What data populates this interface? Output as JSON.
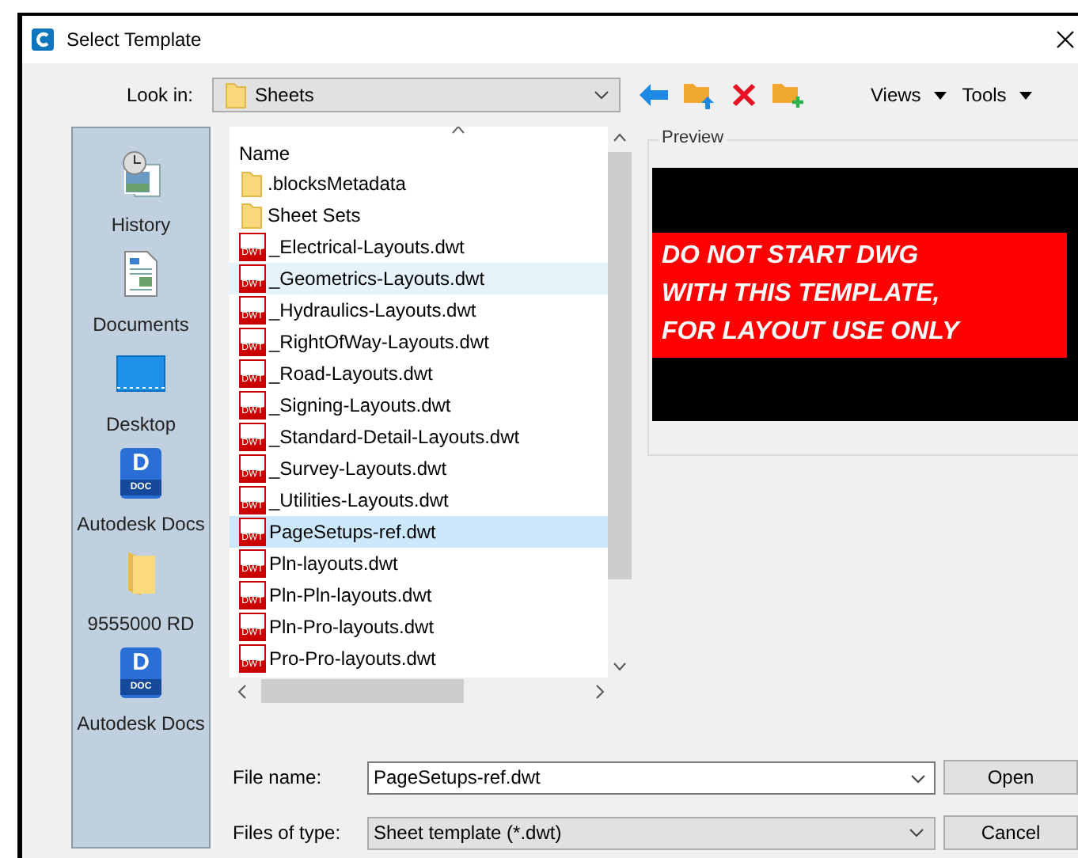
{
  "window": {
    "title": "Select Template"
  },
  "toolbar": {
    "look_in_label": "Look in:",
    "look_in_value": "Sheets",
    "views": "Views",
    "tools": "Tools"
  },
  "places": [
    {
      "kind": "history",
      "label": "History"
    },
    {
      "kind": "documents",
      "label": "Documents"
    },
    {
      "kind": "desktop",
      "label": "Desktop"
    },
    {
      "kind": "docs",
      "label": "Autodesk Docs",
      "badge": "D",
      "badge_caption": "DOC"
    },
    {
      "kind": "folder",
      "label": "9555000 RD"
    },
    {
      "kind": "docs",
      "label": "Autodesk Docs",
      "badge": "D",
      "badge_caption": "DOC"
    }
  ],
  "file_list": {
    "column": "Name",
    "rows": [
      {
        "kind": "folder",
        "name": ".blocksMetadata",
        "selected": false,
        "hover": false
      },
      {
        "kind": "folder",
        "name": "Sheet Sets",
        "selected": false,
        "hover": false
      },
      {
        "kind": "dwt",
        "name": "_Electrical-Layouts.dwt",
        "icon_label": "DWT",
        "selected": false,
        "hover": false
      },
      {
        "kind": "dwt",
        "name": "_Geometrics-Layouts.dwt",
        "icon_label": "DWT",
        "selected": false,
        "hover": true
      },
      {
        "kind": "dwt",
        "name": "_Hydraulics-Layouts.dwt",
        "icon_label": "DWT",
        "selected": false,
        "hover": false
      },
      {
        "kind": "dwt",
        "name": "_RightOfWay-Layouts.dwt",
        "icon_label": "DWT",
        "selected": false,
        "hover": false
      },
      {
        "kind": "dwt",
        "name": "_Road-Layouts.dwt",
        "icon_label": "DWT",
        "selected": false,
        "hover": false
      },
      {
        "kind": "dwt",
        "name": "_Signing-Layouts.dwt",
        "icon_label": "DWT",
        "selected": false,
        "hover": false
      },
      {
        "kind": "dwt",
        "name": "_Standard-Detail-Layouts.dwt",
        "icon_label": "DWT",
        "selected": false,
        "hover": false
      },
      {
        "kind": "dwt",
        "name": "_Survey-Layouts.dwt",
        "icon_label": "DWT",
        "selected": false,
        "hover": false
      },
      {
        "kind": "dwt",
        "name": "_Utilities-Layouts.dwt",
        "icon_label": "DWT",
        "selected": false,
        "hover": false
      },
      {
        "kind": "dwt",
        "name": "PageSetups-ref.dwt",
        "icon_label": "DWT",
        "selected": true,
        "hover": false
      },
      {
        "kind": "dwt",
        "name": "Pln-layouts.dwt",
        "icon_label": "DWT",
        "selected": false,
        "hover": false
      },
      {
        "kind": "dwt",
        "name": "Pln-Pln-layouts.dwt",
        "icon_label": "DWT",
        "selected": false,
        "hover": false
      },
      {
        "kind": "dwt",
        "name": "Pln-Pro-layouts.dwt",
        "icon_label": "DWT",
        "selected": false,
        "hover": false
      },
      {
        "kind": "dwt",
        "name": "Pro-Pro-layouts.dwt",
        "icon_label": "DWT",
        "selected": false,
        "hover": false
      }
    ]
  },
  "preview": {
    "label": "Preview",
    "message": [
      "DO NOT START DWG",
      "WITH THIS TEMPLATE,",
      "FOR LAYOUT USE ONLY"
    ]
  },
  "file_name": {
    "label": "File name:",
    "value": "PageSetups-ref.dwt"
  },
  "file_type": {
    "label": "Files of type:",
    "value": "Sheet template (*.dwt)"
  },
  "buttons": [
    "Open",
    "Cancel"
  ]
}
